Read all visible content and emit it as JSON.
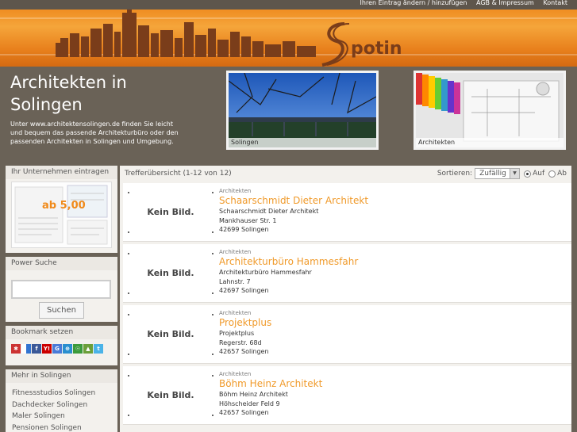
{
  "top_links": [
    "Ihren Eintrag ändern / hinzufügen",
    "AGB & Impressum",
    "Kontakt"
  ],
  "logo_text": "spotin",
  "hero": {
    "title": "Architekten in Solingen",
    "text": "Unter www.architektensolingen.de finden Sie leicht und bequem das passende Architekturbüro oder den passenden Architekten in Solingen und Umgebung.",
    "photos": [
      {
        "caption": "Solingen"
      },
      {
        "caption": "Architekten"
      }
    ]
  },
  "sidebar": {
    "ad": {
      "title": "Ihr Unternehmen eintragen",
      "price": "ab 5,00"
    },
    "search": {
      "title": "Power Suche",
      "value": "",
      "button": "Suchen"
    },
    "bookmark": {
      "title": "Bookmark setzen",
      "icons": [
        "mister-wong-icon",
        "delicious-icon",
        "facebook-icon",
        "yahoo-icon",
        "google-icon",
        "linkarena-icon",
        "stumbleupon-icon",
        "webnews-icon",
        "twitter-icon"
      ]
    },
    "more": {
      "title": "Mehr in Solingen",
      "links": [
        "Fitnessstudios Solingen",
        "Dachdecker Solingen",
        "Maler Solingen",
        "Pensionen Solingen"
      ]
    }
  },
  "main": {
    "summary": "Trefferübersicht (1-12 von 12)",
    "sort_label": "Sortieren:",
    "sort_value": "Zufällig",
    "order_asc": "Auf",
    "order_desc": "Ab",
    "no_image": "Kein Bild.",
    "entries": [
      {
        "category": "Architekten",
        "name": "Schaarschmidt Dieter Architekt",
        "company": "Schaarschmidt Dieter Architekt",
        "street": "Mankhauser Str. 1",
        "city": "42699 Solingen"
      },
      {
        "category": "Architekten",
        "name": "Architekturbüro Hammesfahr",
        "company": "Architekturbüro Hammesfahr",
        "street": "Lahnstr. 7",
        "city": "42697 Solingen"
      },
      {
        "category": "Architekten",
        "name": "Projektplus",
        "company": "Projektplus",
        "street": "Regerstr. 68d",
        "city": "42657 Solingen"
      },
      {
        "category": "Architekten",
        "name": "Böhm Heinz Architekt",
        "company": "Böhm Heinz Architekt",
        "street": "Höhscheider Feld 9",
        "city": "42657 Solingen"
      }
    ]
  },
  "colors": {
    "accent": "#f09a2a",
    "banner": "#ef8d22",
    "background": "#6a6257"
  }
}
